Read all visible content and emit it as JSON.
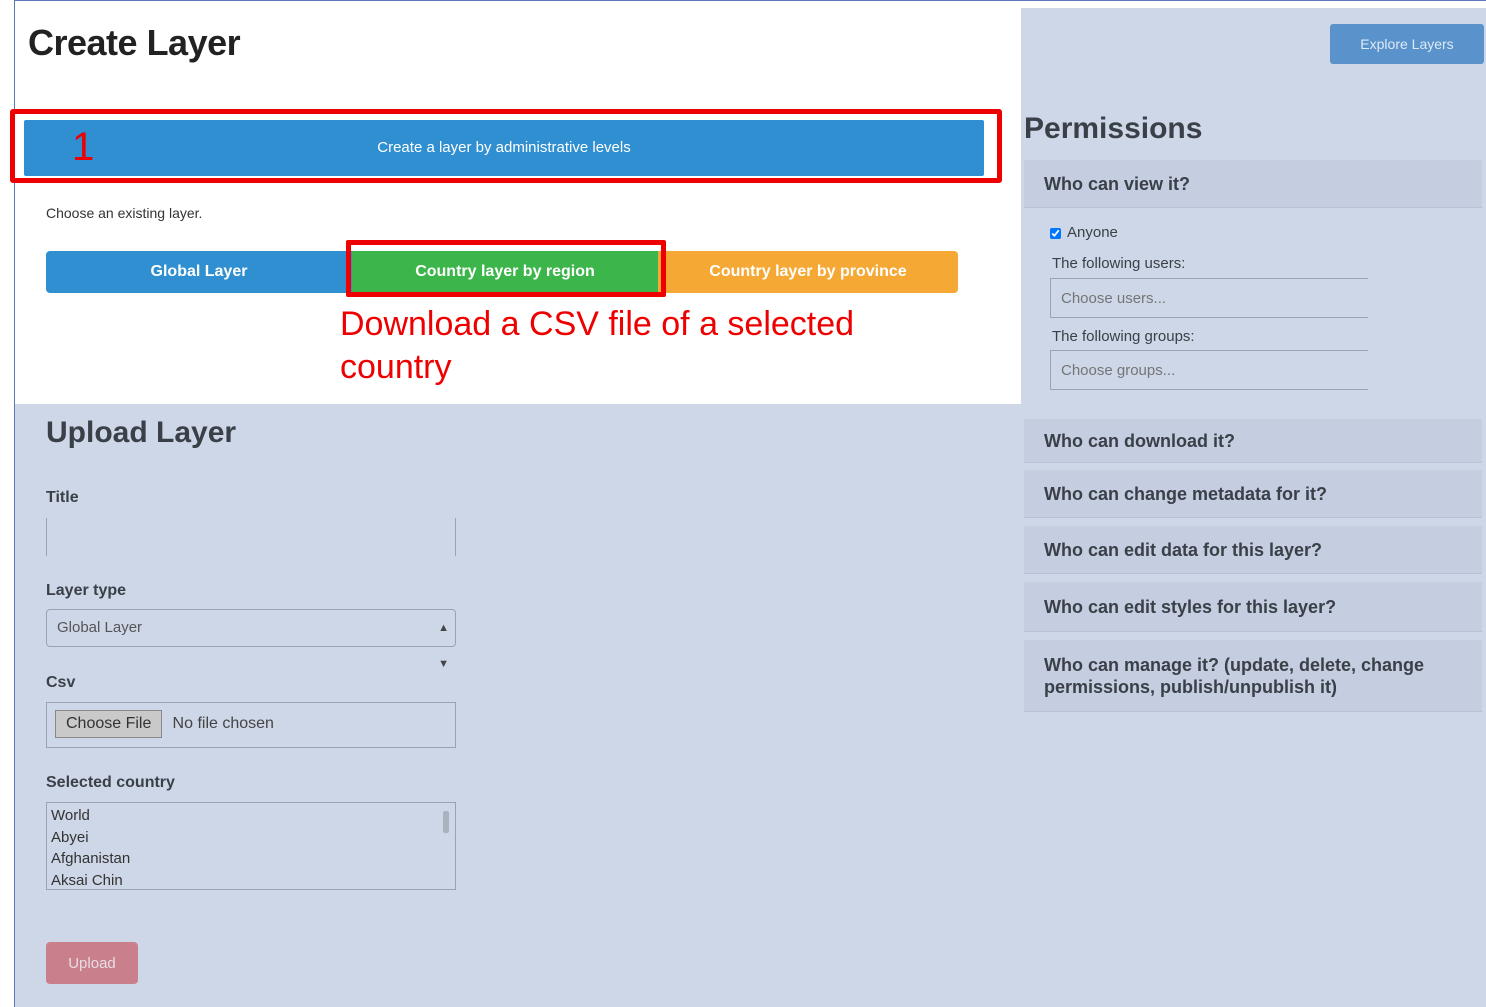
{
  "create": {
    "title": "Create Layer",
    "admin_button": "Create a layer by administrative levels",
    "choose_label": "Choose an existing layer.",
    "tabs": [
      {
        "label": "Global Layer",
        "color": "#2f8fd1"
      },
      {
        "label": "Country layer by region",
        "color": "#3cb54a"
      },
      {
        "label": "Country layer by province",
        "color": "#f5a833"
      }
    ]
  },
  "annotations": {
    "step_number": "1",
    "note": "Download a CSV file of a selected country",
    "color": "#ee0000"
  },
  "upload": {
    "title": "Upload Layer",
    "title_label": "Title",
    "title_value": "",
    "layer_type_label": "Layer type",
    "layer_type_value": "Global Layer",
    "csv_label": "Csv",
    "file_button": "Choose File",
    "file_status": "No file chosen",
    "country_label": "Selected country",
    "countries": [
      "World",
      "Abyei",
      "Afghanistan",
      "Aksai Chin"
    ],
    "upload_button": "Upload"
  },
  "permissions": {
    "explore_button": "Explore Layers",
    "title": "Permissions",
    "view": {
      "header": "Who can view it?",
      "anyone_label": "Anyone",
      "anyone_checked": true,
      "users_label": "The following users:",
      "users_placeholder": "Choose users...",
      "groups_label": "The following groups:",
      "groups_placeholder": "Choose groups..."
    },
    "sections": [
      "Who can download it?",
      "Who can change metadata for it?",
      "Who can edit data for this layer?",
      "Who can edit styles for this layer?",
      "Who can manage it? (update, delete, change permissions, publish/unpublish it)"
    ]
  }
}
